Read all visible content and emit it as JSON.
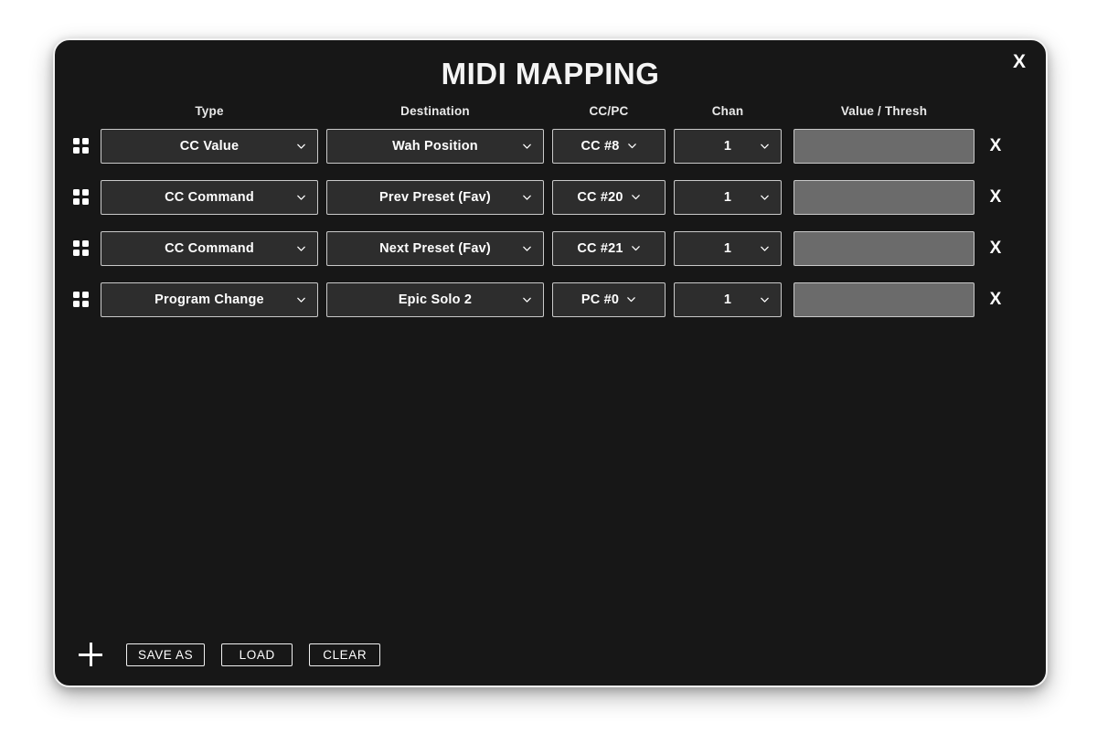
{
  "dialog": {
    "title": "MIDI MAPPING",
    "close_label": "X"
  },
  "table": {
    "headers": {
      "handle": "",
      "type": "Type",
      "destination": "Destination",
      "ccpc": "CC/PC",
      "chan": "Chan",
      "value": "Value / Thresh",
      "delete": ""
    },
    "rows": [
      {
        "handle_icon": "drag-handle-icon",
        "type": "CC Value",
        "destination": "Wah Position",
        "ccpc": "CC #8",
        "chan": "1",
        "value": "",
        "value_placeholder": "",
        "delete_label": "X"
      },
      {
        "handle_icon": "drag-handle-icon",
        "type": "CC Command",
        "destination": "Prev Preset (Fav)",
        "ccpc": "CC #20",
        "chan": "1",
        "value": "",
        "value_placeholder": "",
        "delete_label": "X"
      },
      {
        "handle_icon": "drag-handle-icon",
        "type": "CC Command",
        "destination": "Next Preset (Fav)",
        "ccpc": "CC #21",
        "chan": "1",
        "value": "",
        "value_placeholder": "",
        "delete_label": "X"
      },
      {
        "handle_icon": "drag-handle-icon",
        "type": "Program Change",
        "destination": "Epic Solo 2",
        "ccpc": "PC #0",
        "chan": "1",
        "value": "",
        "value_placeholder": "",
        "delete_label": "X"
      }
    ]
  },
  "footer": {
    "add_icon": "plus-icon",
    "save_as_label": "SAVE AS",
    "load_label": "LOAD",
    "clear_label": "CLEAR"
  },
  "colors": {
    "page_background": "#ffffff",
    "panel_background": "#171717",
    "panel_border": "#f2f2f2",
    "select_background": "#2d2d2d",
    "control_border": "#c9c9c9",
    "value_field_background": "#6b6b6b",
    "text": "#ffffff"
  }
}
